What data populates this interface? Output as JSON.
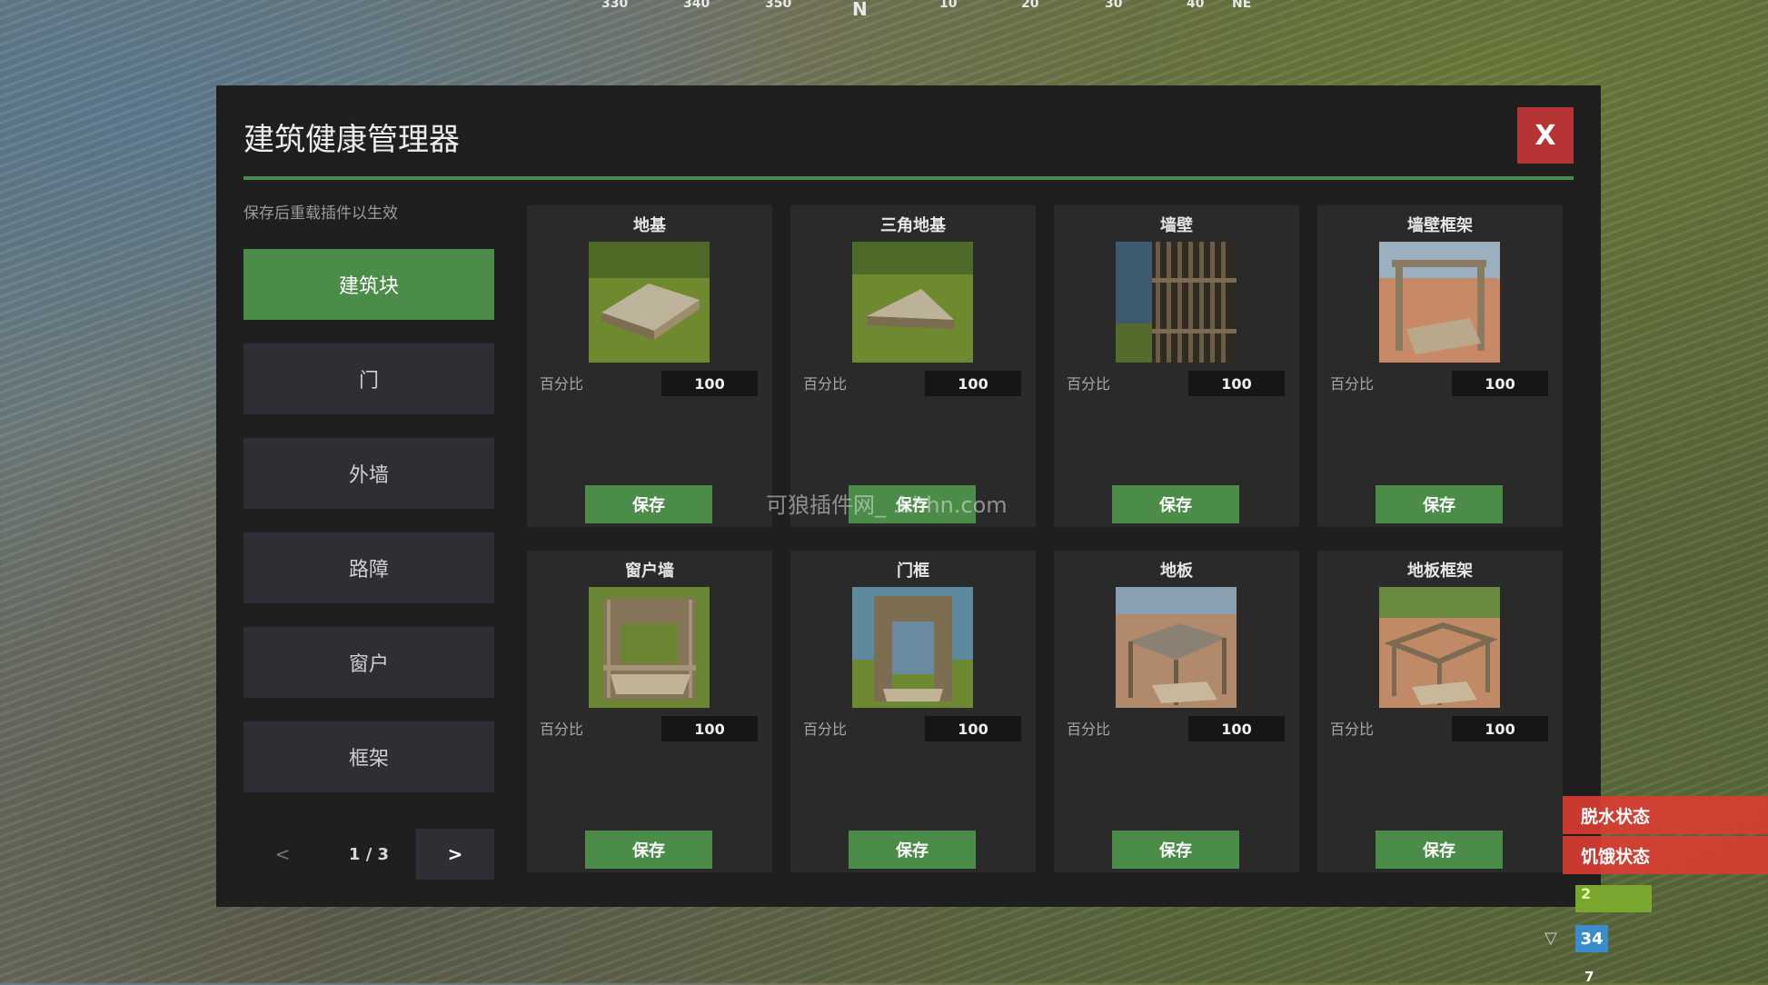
{
  "compass": [
    {
      "text": "330",
      "big": false
    },
    {
      "text": "340",
      "big": false
    },
    {
      "text": "350",
      "big": false
    },
    {
      "text": "N",
      "big": true
    },
    {
      "text": "10",
      "big": false
    },
    {
      "text": "20",
      "big": false
    },
    {
      "text": "30",
      "big": false
    },
    {
      "text": "40",
      "big": false
    },
    {
      "text": "NE",
      "big": false
    }
  ],
  "panel": {
    "title": "建筑健康管理器",
    "close_label": "X",
    "hint": "保存后重载插件以生效"
  },
  "sidebar": {
    "items": [
      {
        "label": "建筑块",
        "active": true
      },
      {
        "label": "门",
        "active": false
      },
      {
        "label": "外墙",
        "active": false
      },
      {
        "label": "路障",
        "active": false
      },
      {
        "label": "窗户",
        "active": false
      },
      {
        "label": "框架",
        "active": false
      }
    ],
    "pager": {
      "prev": "<",
      "label": "1 / 3",
      "next": ">"
    }
  },
  "cards": [
    {
      "title": "地基",
      "pct_label": "百分比",
      "value": "100",
      "save_label": "保存",
      "image": "foundation"
    },
    {
      "title": "三角地基",
      "pct_label": "百分比",
      "value": "100",
      "save_label": "保存",
      "image": "triangle-foundation"
    },
    {
      "title": "墙壁",
      "pct_label": "百分比",
      "value": "100",
      "save_label": "保存",
      "image": "wall"
    },
    {
      "title": "墙壁框架",
      "pct_label": "百分比",
      "value": "100",
      "save_label": "保存",
      "image": "wall-frame"
    },
    {
      "title": "窗户墙",
      "pct_label": "百分比",
      "value": "100",
      "save_label": "保存",
      "image": "window-wall"
    },
    {
      "title": "门框",
      "pct_label": "百分比",
      "value": "100",
      "save_label": "保存",
      "image": "doorway"
    },
    {
      "title": "地板",
      "pct_label": "百分比",
      "value": "100",
      "save_label": "保存",
      "image": "floor"
    },
    {
      "title": "地板框架",
      "pct_label": "百分比",
      "value": "100",
      "save_label": "保存",
      "image": "floor-frame"
    }
  ],
  "watermark": "可狼插件网_ .khhn.com",
  "hud": {
    "water": "脱水状态",
    "hunger": "饥饿状态",
    "health": "2",
    "stat": "34",
    "bottom": "7"
  },
  "colors": {
    "accent": "#4b8c48",
    "close": "#b73434",
    "panel": "#1f1f1f",
    "card": "#2a2a2a",
    "hud_red": "#dc3c32"
  }
}
